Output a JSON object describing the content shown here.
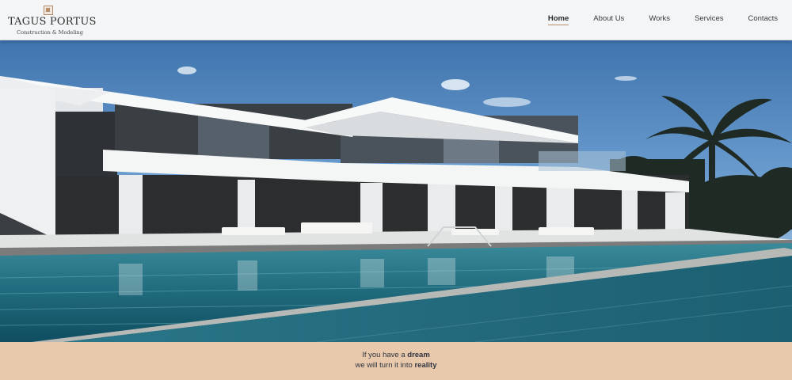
{
  "brand": {
    "name": "TAGUS PORTUS",
    "tagline": "Construction & Modeling"
  },
  "nav": {
    "items": [
      "Home",
      "About Us",
      "Works",
      "Services",
      "Contacts"
    ],
    "active": "Home"
  },
  "hero": {
    "image": "modern-villa-with-pool"
  },
  "banner": {
    "line1_prefix": "If you have a ",
    "line1_bold": "dream",
    "line2_prefix": "we will turn it into ",
    "line2_bold": "reality"
  },
  "colors": {
    "accent": "#b98c6a",
    "banner_bg": "#e8c9ac",
    "header_bg": "#f4f5f6"
  }
}
